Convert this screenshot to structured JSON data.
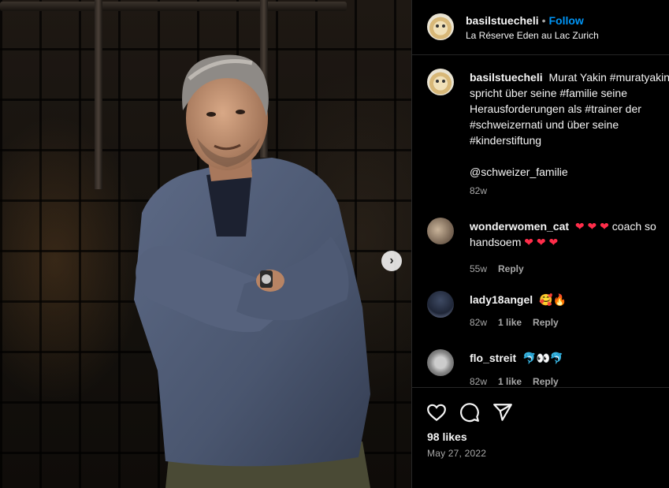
{
  "post": {
    "author": "basilstuecheli",
    "separator": "•",
    "follow_label": "Follow",
    "location": "La Réserve Eden au Lac Zurich",
    "likes": "98 likes",
    "date": "May 27, 2022"
  },
  "caption": {
    "author": "basilstuecheli",
    "text": "Murat Yakin #muratyakin spricht über seine #familie seine Herausforderungen als #trainer der #schweizernati und über seine #kinderstiftung\n\n@schweizer_familie",
    "age": "82w"
  },
  "comments": [
    {
      "author": "wonderwomen_cat",
      "text_before": "",
      "emoji_1": "❤ ❤ ❤",
      "text_mid": "coach so handsoem",
      "emoji_2": "❤ ❤ ❤",
      "age": "55w",
      "likes": "",
      "reply_label": "Reply"
    },
    {
      "author": "lady18angel",
      "emoji": "🥰🔥",
      "age": "82w",
      "likes": "1 like",
      "reply_label": "Reply"
    },
    {
      "author": "flo_streit",
      "emoji": "🐬👀🐬",
      "age": "82w",
      "likes": "1 like",
      "reply_label": "Reply"
    }
  ],
  "icons": {
    "next": "chevron-right-icon",
    "like": "heart-icon",
    "comment": "comment-icon",
    "share": "send-icon"
  },
  "colors": {
    "accent": "#0095f6",
    "heart": "#ff2d4a",
    "muted": "#a8a8a8",
    "background": "#000000"
  }
}
